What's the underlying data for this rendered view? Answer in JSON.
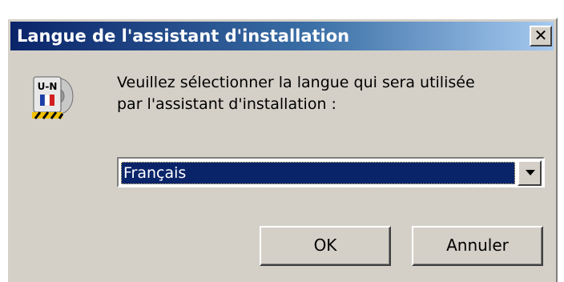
{
  "window": {
    "title": "Langue de l'assistant d'installation",
    "close_glyph": "✕",
    "close_icon": "close-icon",
    "title_bar_colors": [
      "#0a246a",
      "#a6caf0"
    ]
  },
  "app_icon": {
    "name": "installer-icon",
    "label_text": "U-N"
  },
  "content": {
    "prompt_line1": "Veuillez sélectionner la langue qui sera utilisée",
    "prompt_line2": "par l'assistant d'installation :"
  },
  "language_select": {
    "selected": "Français",
    "arrow_icon": "chevron-down-icon",
    "highlight_color": "#0a246a"
  },
  "buttons": {
    "ok_label": "OK",
    "cancel_label": "Annuler"
  }
}
